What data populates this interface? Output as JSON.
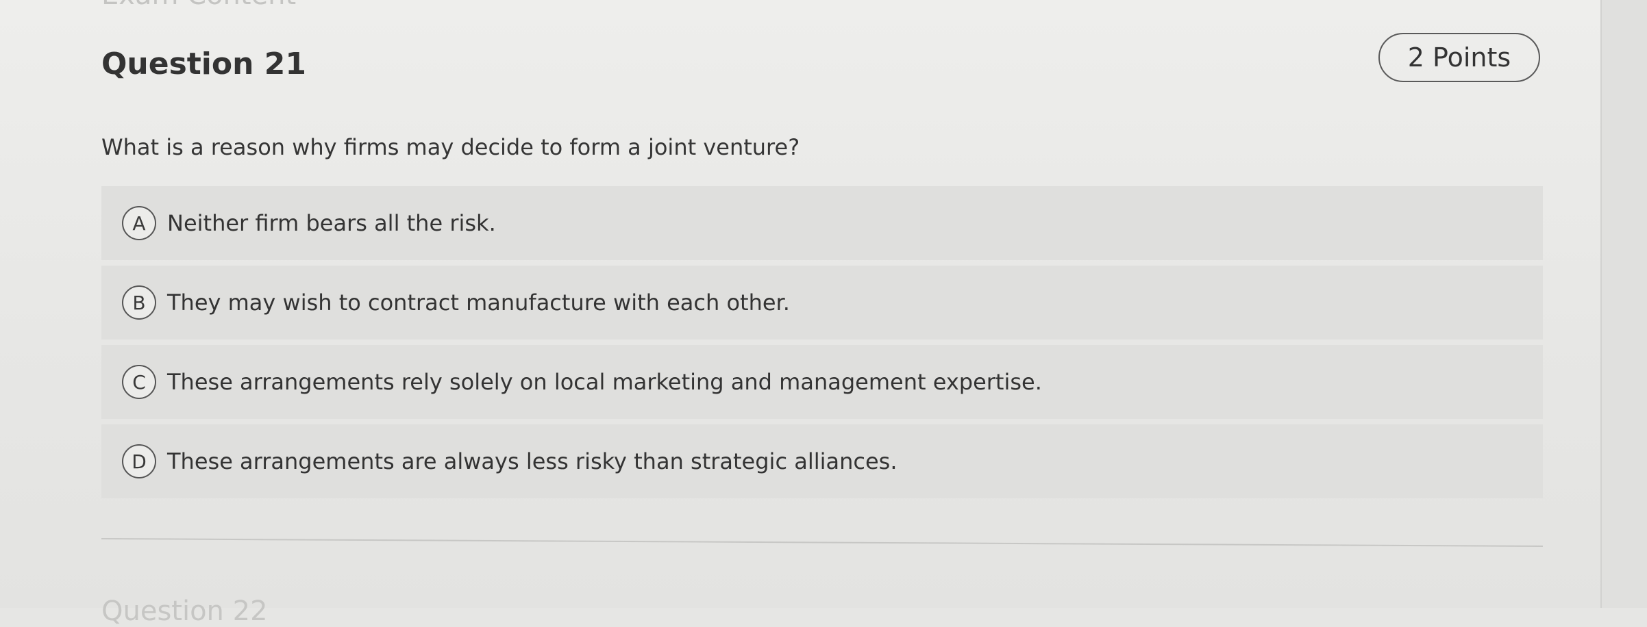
{
  "header": {
    "top_cut_text": "Exam Content",
    "question_title": "Question 21",
    "points_label": "2 Points"
  },
  "question": {
    "prompt": "What is a reason why firms may decide to form a joint venture?",
    "options": [
      {
        "letter": "A",
        "text": "Neither firm bears all the risk."
      },
      {
        "letter": "B",
        "text": "They may wish to contract manufacture with each other."
      },
      {
        "letter": "C",
        "text": "These arrangements rely solely on local marketing and management expertise."
      },
      {
        "letter": "D",
        "text": "These arrangements are always less risky than strategic alliances."
      }
    ]
  },
  "footer": {
    "next_question_cut": "Question 22"
  }
}
